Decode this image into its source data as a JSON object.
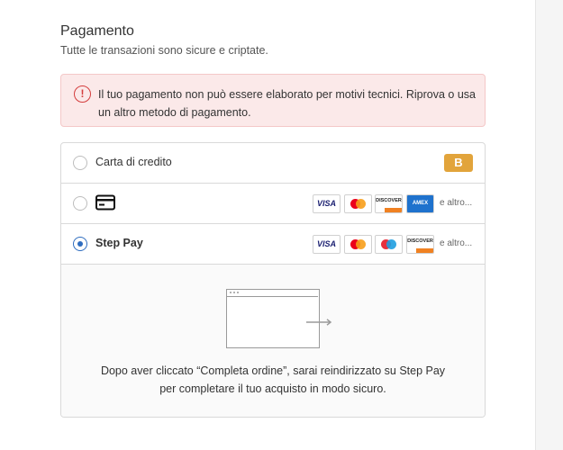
{
  "header": {
    "title": "Pagamento",
    "subtitle": "Tutte le transazioni sono sicure e criptate."
  },
  "alert": {
    "icon": "alert-circle-icon",
    "message": "Il tuo pagamento non può essere elaborato per motivi tecnici. Riprova o usa un altro metodo di pagamento.",
    "color": "#d43d3d"
  },
  "payment_methods": [
    {
      "label": "Carta di credito",
      "selected": false,
      "badge": "B",
      "badge_color": "#e2a43b"
    },
    {
      "label": "",
      "icon": "credit-card-icon",
      "selected": false,
      "brands": [
        "VISA",
        "DISCOVER",
        "AMEX"
      ],
      "more": "e altro..."
    },
    {
      "label": "Step Pay",
      "selected": true,
      "brands": [
        "VISA",
        "DISCOVER"
      ],
      "more": "e altro..."
    }
  ],
  "redirect_panel": {
    "icon": "browser-redirect-icon",
    "text": "Dopo aver cliccato “Completa ordine”, sarai reindirizzato su Step Pay per completare il tuo acquisto in modo sicuro."
  },
  "colors": {
    "accent": "#2f6dbf",
    "error_bg": "#fbe9e9"
  }
}
